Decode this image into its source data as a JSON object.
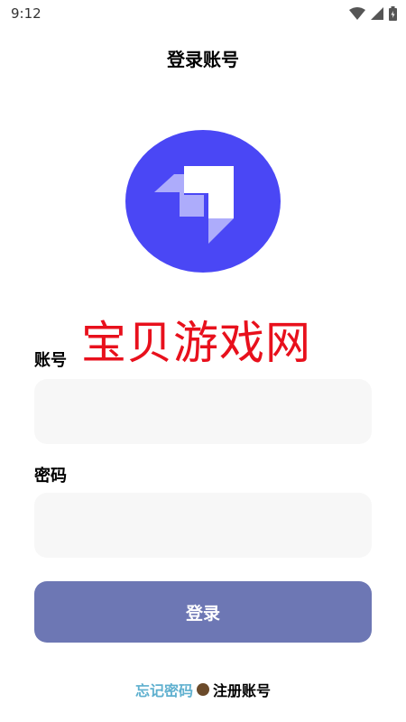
{
  "status_bar": {
    "time": "9:12",
    "icons": [
      "wifi-icon",
      "signal-icon",
      "battery-icon"
    ]
  },
  "header": {
    "title": "登录账号"
  },
  "logo": {
    "icon": "app-logo-icon",
    "circle_color": "#4a47f5"
  },
  "watermark": {
    "text": "宝贝游戏网",
    "color": "#e8101c"
  },
  "form": {
    "account_label": "账号",
    "account_value": "",
    "password_label": "密码",
    "password_value": "",
    "login_label": "登录",
    "login_color": "#6d77b4"
  },
  "footer": {
    "forgot_label": "忘记密码",
    "register_label": "注册账号"
  }
}
